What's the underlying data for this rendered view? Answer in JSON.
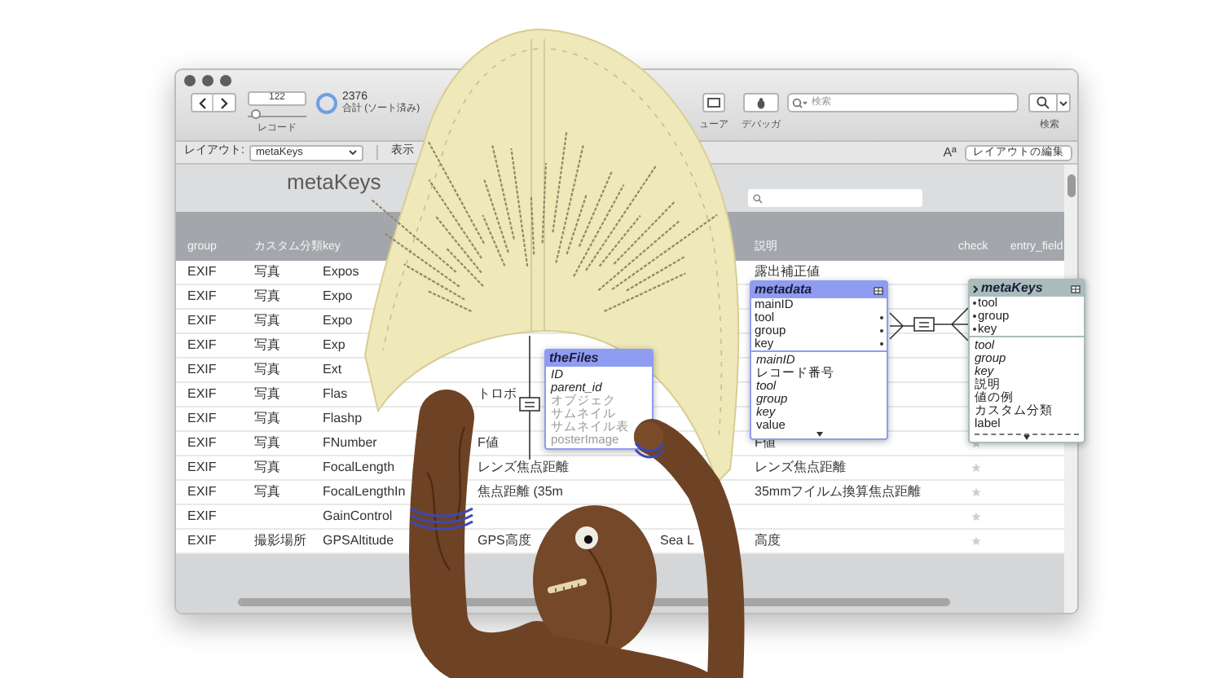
{
  "toolbar": {
    "record_field": {
      "value": "122"
    },
    "record_slider": {
      "level": 0.05
    },
    "total_count": "2376",
    "total_caption": "合計 (ソート済み)",
    "record_label": "レコード",
    "viewer_label": "ューア",
    "debugger_label": "デバッガ",
    "search_field": {
      "placeholder": "検索"
    },
    "search_label": "検索"
  },
  "layout_bar": {
    "label": "レイアウト:",
    "layout_menu": "metaKeys",
    "view_label": "表示",
    "format_glyph": "Aª",
    "edit_layout_button": "レイアウトの編集"
  },
  "header": {
    "title": "metaKeys"
  },
  "table": {
    "columns": [
      "group",
      "カスタム分類",
      "key",
      "説明",
      "check",
      "entry_field"
    ],
    "rows": [
      {
        "group": "EXIF",
        "category": "写真",
        "key": "Expos",
        "description": "露出補正値",
        "check_icon": false
      },
      {
        "group": "EXIF",
        "category": "写真",
        "key": "Expo",
        "check_icon": false
      },
      {
        "group": "EXIF",
        "category": "写真",
        "key": "Expo",
        "check_icon": false
      },
      {
        "group": "EXIF",
        "category": "写真",
        "key": "Exp",
        "check_icon": false
      },
      {
        "group": "EXIF",
        "category": "写真",
        "key": "Ext",
        "check_icon": false
      },
      {
        "group": "EXIF",
        "category": "写真",
        "key": "Flas",
        "column_4": "トロボ",
        "check_icon": false
      },
      {
        "group": "EXIF",
        "category": "写真",
        "key": "Flashp",
        "check_icon": false
      },
      {
        "group": "EXIF",
        "category": "写真",
        "key": "FNumber",
        "column_4": "F値",
        "description": "F値",
        "check_icon": true
      },
      {
        "group": "EXIF",
        "category": "写真",
        "key": "FocalLength",
        "column_4": "レンズ焦点距離",
        "description": "レンズ焦点距離",
        "check_icon": true
      },
      {
        "group": "EXIF",
        "category": "写真",
        "key": "FocalLengthIn",
        "column_4": "焦点距離 (35m",
        "description": "35mmフイルム換算焦点距離",
        "check_icon": true
      },
      {
        "group": "EXIF",
        "key": "GainControl",
        "check_icon": true
      },
      {
        "group": "EXIF",
        "category": "撮影場所",
        "key": "GPSAltitude",
        "column_4": "GPS高度",
        "column_5": "Sea L",
        "description": "高度",
        "check_icon": true
      }
    ]
  },
  "relationship_graph": {
    "tables": [
      {
        "name": "theFiles",
        "color": "#8e9cf2",
        "fields": [
          {
            "text": "ID",
            "italic": true,
            "dimmed": false
          },
          {
            "text": "parent_id",
            "italic": true,
            "dimmed": false
          },
          {
            "text": "オブジェク",
            "italic": false,
            "dimmed": true
          },
          {
            "text": "サムネイル",
            "italic": false,
            "dimmed": true
          },
          {
            "text": "サムネイル表",
            "italic": false,
            "dimmed": true
          },
          {
            "text": "posterImage",
            "italic": false,
            "dimmed": true
          }
        ]
      },
      {
        "name": "metadata",
        "color": "#8e9cf2",
        "key_fields": [
          {
            "text": "mainID",
            "linked": false
          },
          {
            "text": "tool",
            "linked": true
          },
          {
            "text": "group",
            "linked": true
          },
          {
            "text": "key",
            "linked": true
          }
        ],
        "fields": [
          {
            "text": "mainID",
            "italic": true,
            "dimmed": false
          },
          {
            "text": "レコード番号",
            "italic": false,
            "dimmed": false
          },
          {
            "text": "tool",
            "italic": true,
            "dimmed": false
          },
          {
            "text": "group",
            "italic": true,
            "dimmed": false
          },
          {
            "text": "key",
            "italic": true,
            "dimmed": false
          },
          {
            "text": "value",
            "italic": false,
            "dimmed": false
          }
        ]
      },
      {
        "name": "metaKeys",
        "color": "#a9bcbb",
        "key_fields": [
          {
            "text": "tool",
            "linked": true
          },
          {
            "text": "group",
            "linked": true
          },
          {
            "text": "key",
            "linked": true
          }
        ],
        "fields": [
          {
            "text": "tool",
            "italic": true,
            "dimmed": false
          },
          {
            "text": "group",
            "italic": true,
            "dimmed": false
          },
          {
            "text": "key",
            "italic": true,
            "dimmed": false
          },
          {
            "text": "説明",
            "italic": false,
            "dimmed": false
          },
          {
            "text": "値の例",
            "italic": false,
            "dimmed": false
          },
          {
            "text": "カスタム分類",
            "italic": false,
            "dimmed": false
          },
          {
            "text": "label",
            "italic": false,
            "dimmed": false
          }
        ]
      }
    ]
  }
}
